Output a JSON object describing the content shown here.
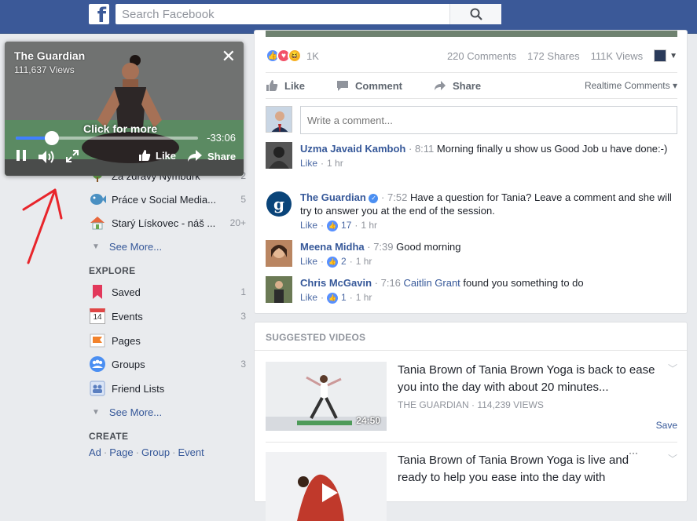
{
  "header": {
    "logo": "f",
    "search_placeholder": "Search Facebook"
  },
  "sidebar": {
    "items_top": [
      {
        "label": "Za zdravý Nymburk",
        "count": "2"
      },
      {
        "label": "Práce v Social Media...",
        "count": "5"
      },
      {
        "label": "Starý Lískovec - náš ...",
        "count": "20+"
      }
    ],
    "see_more_1": "See More...",
    "explore_label": "EXPLORE",
    "explore": [
      {
        "label": "Saved",
        "count": "1"
      },
      {
        "label": "Events",
        "count": "3",
        "icon_text": "14"
      },
      {
        "label": "Pages",
        "count": ""
      },
      {
        "label": "Groups",
        "count": "3"
      },
      {
        "label": "Friend Lists",
        "count": ""
      }
    ],
    "see_more_2": "See More...",
    "create_label": "CREATE",
    "create_links": [
      "Ad",
      "Page",
      "Group",
      "Event"
    ]
  },
  "post": {
    "reaction_count": "1K",
    "comments": "220 Comments",
    "shares": "172 Shares",
    "views": "111K Views",
    "actions": {
      "like": "Like",
      "comment": "Comment",
      "share": "Share"
    },
    "realtime": "Realtime Comments ▾",
    "comment_placeholder": "Write a comment...",
    "comments_list": [
      {
        "name": "Uzma Javaid Kamboh",
        "time": "8:11",
        "text": "Morning finally u show us Good Job u have done:-)",
        "like": "Like",
        "likes": "",
        "ago": "1 hr"
      },
      {
        "name": "The Guardian",
        "time": "7:52",
        "text": "Have a question for Tania? Leave a comment and she will try to answer you at the end of the session.",
        "like": "Like",
        "likes": "17",
        "ago": "1 hr"
      },
      {
        "name": "Meena Midha",
        "time": "7:39",
        "text": "Good morning",
        "like": "Like",
        "likes": "2",
        "ago": "1 hr"
      },
      {
        "name": "Chris McGavin",
        "time": "7:16",
        "mention": "Caitlin Grant",
        "text": "found you something to do",
        "like": "Like",
        "likes": "1",
        "ago": "1 hr"
      }
    ]
  },
  "suggested": {
    "header": "SUGGESTED VIDEOS",
    "videos": [
      {
        "title": "Tania Brown of Tania Brown Yoga is back to ease you into the day with about 20 minutes...",
        "source": "THE GUARDIAN · 114,239 VIEWS",
        "duration": "24:50",
        "save": "Save"
      },
      {
        "title": "Tania Brown of Tania Brown Yoga is live and ready to help you ease into the day with",
        "source": "",
        "duration": "",
        "save": ""
      }
    ]
  },
  "player": {
    "title": "The Guardian",
    "views": "111,637 Views",
    "click_more": "Click for more",
    "time_left": "-33:06",
    "progress": 0.2,
    "like": "Like",
    "share": "Share"
  },
  "colors": {
    "brand": "#3b5998",
    "link": "#365899",
    "annotation": "#e8252b"
  }
}
